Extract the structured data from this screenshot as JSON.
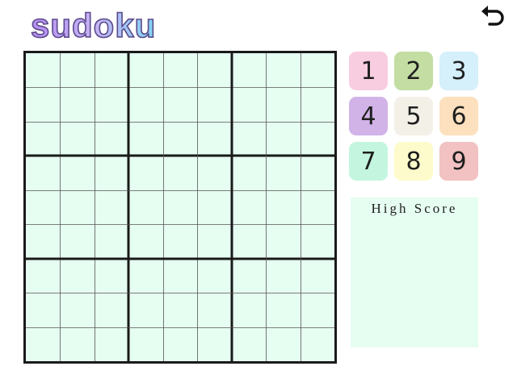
{
  "app": {
    "logo_text": "sudoku"
  },
  "toolbar": {
    "undo_icon": "undo-arrow-icon"
  },
  "board": {
    "rows": 9,
    "cols": 9,
    "cells": [
      [
        "",
        "",
        "",
        "",
        "",
        "",
        "",
        "",
        ""
      ],
      [
        "",
        "",
        "",
        "",
        "",
        "",
        "",
        "",
        ""
      ],
      [
        "",
        "",
        "",
        "",
        "",
        "",
        "",
        "",
        ""
      ],
      [
        "",
        "",
        "",
        "",
        "",
        "",
        "",
        "",
        ""
      ],
      [
        "",
        "",
        "",
        "",
        "",
        "",
        "",
        "",
        ""
      ],
      [
        "",
        "",
        "",
        "",
        "",
        "",
        "",
        "",
        ""
      ],
      [
        "",
        "",
        "",
        "",
        "",
        "",
        "",
        "",
        ""
      ],
      [
        "",
        "",
        "",
        "",
        "",
        "",
        "",
        "",
        ""
      ],
      [
        "",
        "",
        "",
        "",
        "",
        "",
        "",
        "",
        ""
      ]
    ],
    "background_color": "#e6fdf2",
    "line_color": "#1a1a1a"
  },
  "numpad": {
    "buttons": [
      {
        "label": "1",
        "color": "#f9cde0"
      },
      {
        "label": "2",
        "color": "#c3dda3"
      },
      {
        "label": "3",
        "color": "#d5effb"
      },
      {
        "label": "4",
        "color": "#d1b3e8"
      },
      {
        "label": "5",
        "color": "#f3f0e8"
      },
      {
        "label": "6",
        "color": "#fde0bd"
      },
      {
        "label": "7",
        "color": "#c4f6df"
      },
      {
        "label": "8",
        "color": "#fdfbcb"
      },
      {
        "label": "9",
        "color": "#f2c1c1"
      }
    ]
  },
  "high_score": {
    "title": "High Score",
    "background_color": "#e6fdf2"
  }
}
